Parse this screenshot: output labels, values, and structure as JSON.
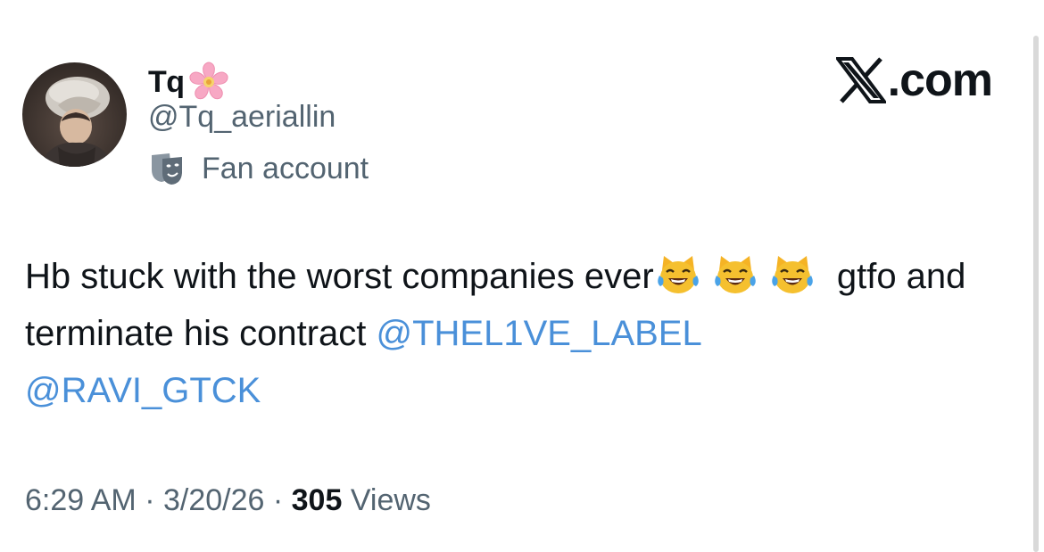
{
  "author": {
    "display_name": "Tq",
    "name_emoji": "cherry-blossom",
    "handle": "@Tq_aeriallin",
    "label_icon": "theater-mask-icon",
    "label_text": "Fan account"
  },
  "branding": {
    "domain_suffix": ".com"
  },
  "tweet": {
    "text_part1": "Hb stuck with the worst companies ever",
    "emoji_name": "cat-with-tears-of-joy",
    "text_part2": " gtfo and terminate his contract ",
    "mention1": "@THEL1VE_LABEL",
    "mention2": "@RAVI_GTCK"
  },
  "meta": {
    "time": "6:29 AM",
    "separator": " · ",
    "date": "3/20/26",
    "views_count": "305",
    "views_label": " Views"
  },
  "colors": {
    "text": "#0f1419",
    "secondary": "#536471",
    "mention": "#4a90d9"
  }
}
